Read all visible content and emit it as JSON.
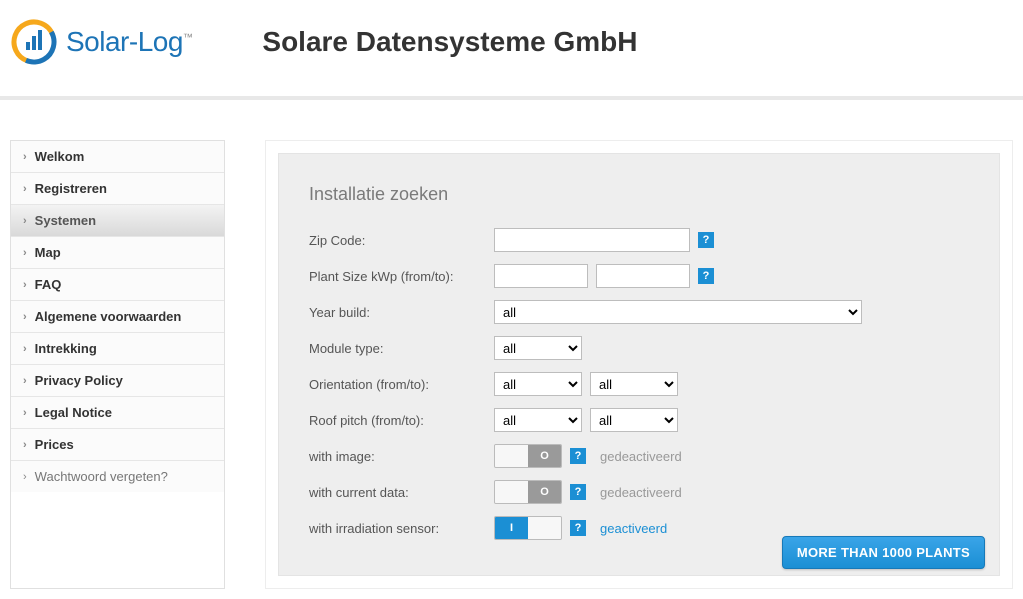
{
  "header": {
    "logo_text": "Solar-Log",
    "logo_tm": "™",
    "title": "Solare Datensysteme GmbH"
  },
  "sidebar": {
    "items": [
      {
        "label": "Welkom",
        "active": false,
        "dim": false
      },
      {
        "label": "Registreren",
        "active": false,
        "dim": false
      },
      {
        "label": "Systemen",
        "active": true,
        "dim": false
      },
      {
        "label": "Map",
        "active": false,
        "dim": false
      },
      {
        "label": "FAQ",
        "active": false,
        "dim": false
      },
      {
        "label": "Algemene voorwaarden",
        "active": false,
        "dim": false
      },
      {
        "label": "Intrekking",
        "active": false,
        "dim": false
      },
      {
        "label": "Privacy Policy",
        "active": false,
        "dim": false
      },
      {
        "label": "Legal Notice",
        "active": false,
        "dim": false
      },
      {
        "label": "Prices",
        "active": false,
        "dim": false
      },
      {
        "label": "Wachtwoord vergeten?",
        "active": false,
        "dim": true
      }
    ]
  },
  "form": {
    "title": "Installatie zoeken",
    "zip_label": "Zip Code:",
    "zip_value": "",
    "plant_size_label": "Plant Size kWp (from/to):",
    "plant_size_from": "",
    "plant_size_to": "",
    "year_label": "Year build:",
    "year_value": "all",
    "module_label": "Module type:",
    "module_value": "all",
    "orientation_label": "Orientation (from/to):",
    "orientation_from": "all",
    "orientation_to": "all",
    "roof_label": "Roof pitch (from/to):",
    "roof_from": "all",
    "roof_to": "all",
    "with_image_label": "with image:",
    "with_current_label": "with current data:",
    "with_irrad_label": "with irradiation sensor:",
    "state_off": "gedeactiveerd",
    "state_on": "geactiveerd",
    "toggle_off_glyph": "O",
    "toggle_on_glyph": "I",
    "help_glyph": "?",
    "button_label": "MORE THAN 1000 PLANTS"
  }
}
